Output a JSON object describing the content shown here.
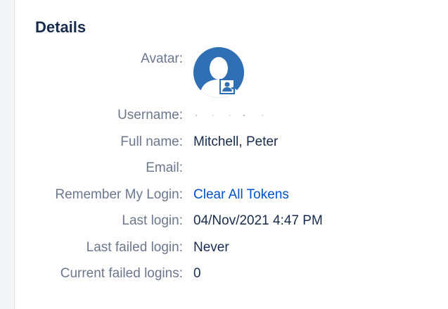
{
  "section": {
    "title": "Details"
  },
  "fields": {
    "avatar_label": "Avatar:",
    "username_label": "Username:",
    "fullname_label": "Full name:",
    "fullname_value": "Mitchell, Peter",
    "email_label": "Email:",
    "remember_label": "Remember My Login:",
    "remember_link": "Clear All Tokens",
    "last_login_label": "Last login:",
    "last_login_value": "04/Nov/2021 4:47 PM",
    "last_failed_label": "Last failed login:",
    "last_failed_value": "Never",
    "current_failed_label": "Current failed logins:",
    "current_failed_value": "0"
  },
  "icons": {
    "avatar": "default-user-avatar-icon",
    "avatar_edit": "change-avatar-icon"
  },
  "colors": {
    "link": "#0052cc",
    "label": "#6b778c",
    "text": "#172b4d",
    "avatar_bg": "#2f6fb4"
  }
}
